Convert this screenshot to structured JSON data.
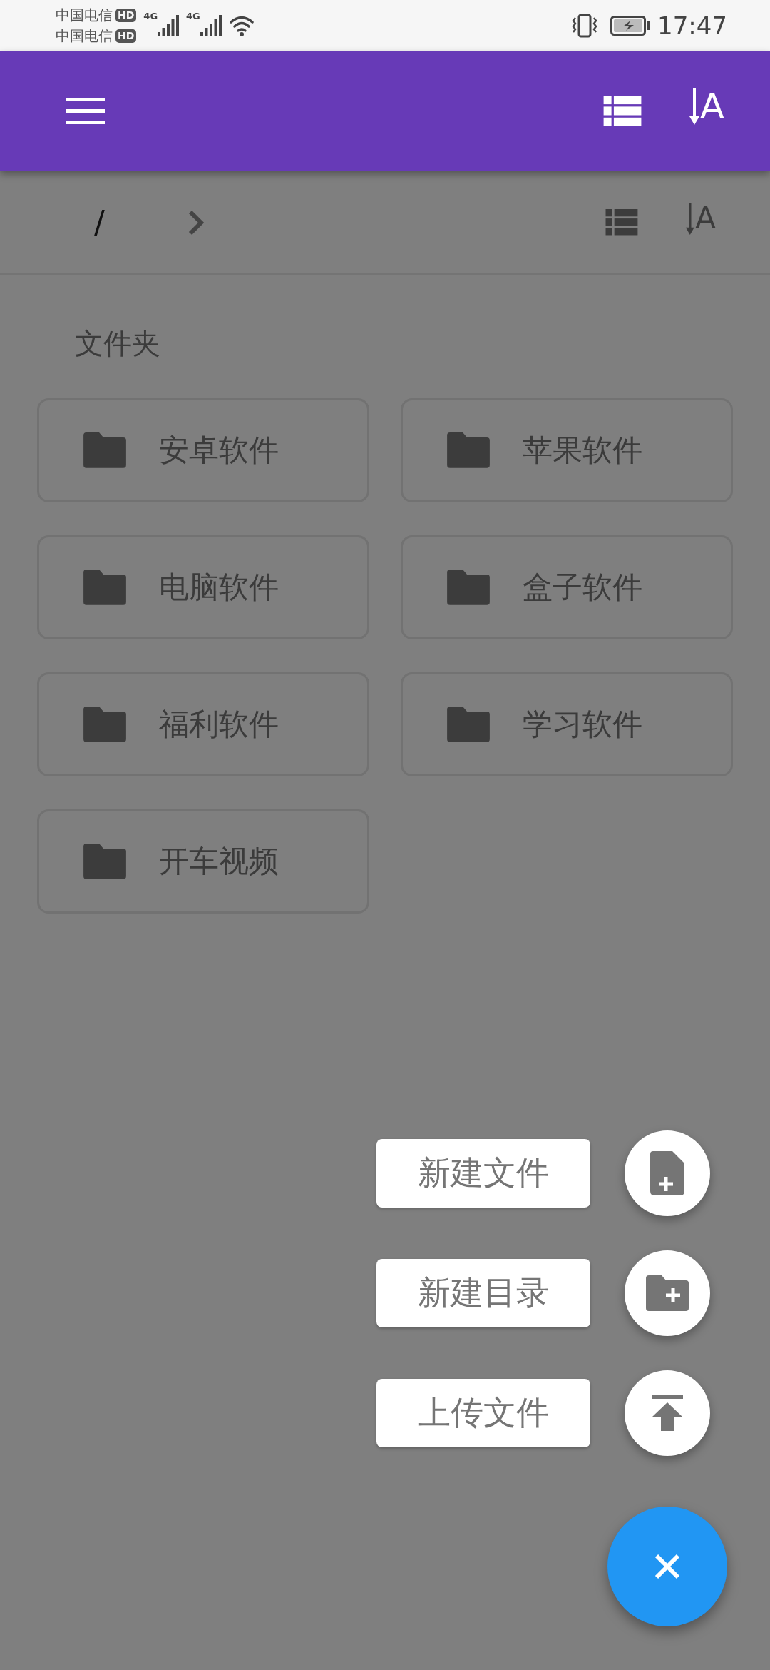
{
  "status_bar": {
    "carriers": [
      {
        "name": "中国电信",
        "badge": "HD"
      },
      {
        "name": "中国电信",
        "badge": "HD"
      }
    ],
    "networks": [
      "4G",
      "4G"
    ],
    "time": "17:47"
  },
  "app_bar": {
    "actions": [
      {
        "kind": "view-list"
      },
      {
        "kind": "sort",
        "label": "A"
      }
    ]
  },
  "path_bar": {
    "path": "/",
    "actions": [
      {
        "kind": "view-list"
      },
      {
        "kind": "sort",
        "label": "A"
      }
    ]
  },
  "section_title": "文件夹",
  "folders": [
    {
      "name": "安卓软件"
    },
    {
      "name": "苹果软件"
    },
    {
      "name": "电脑软件"
    },
    {
      "name": "盒子软件"
    },
    {
      "name": "福利软件"
    },
    {
      "name": "学习软件"
    },
    {
      "name": "开车视频"
    }
  ],
  "fab": {
    "expanded": true,
    "menu": [
      {
        "kind": "new-file",
        "label": "新建文件"
      },
      {
        "kind": "new-folder",
        "label": "新建目录"
      },
      {
        "kind": "upload",
        "label": "上传文件"
      }
    ]
  }
}
